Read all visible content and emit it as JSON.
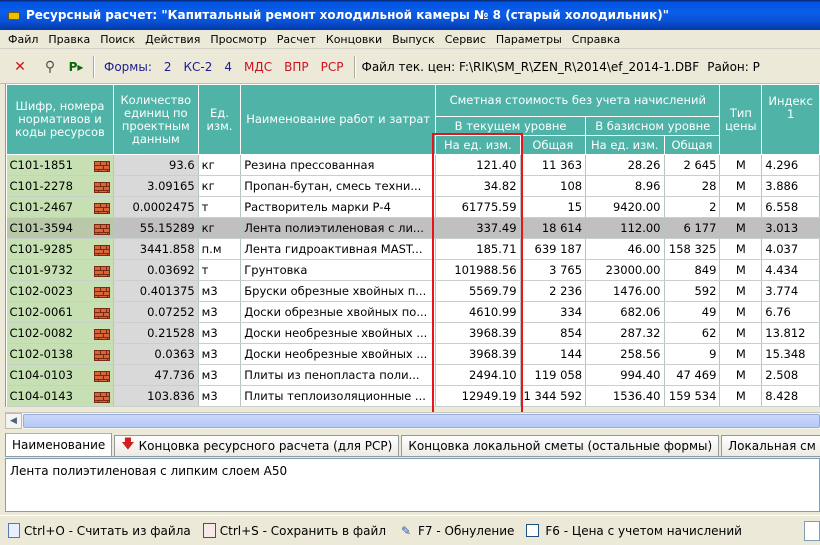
{
  "window": {
    "title": "Ресурсный расчет: \"Капитальный ремонт холодильной камеры № 8 (старый холодильник)\""
  },
  "menu": [
    "Файл",
    "Правка",
    "Поиск",
    "Действия",
    "Просмотр",
    "Расчет",
    "Концовки",
    "Выпуск",
    "Сервис",
    "Параметры",
    "Справка"
  ],
  "toolbar": {
    "delete_icon": "✕",
    "binoculars_icon": "⚲",
    "run_icon": "P▸",
    "forms_label": "Формы:",
    "forms": [
      "2",
      "КС-2",
      "4",
      "МДС",
      "ВПР",
      "РСР"
    ],
    "file_label": "Файл тек. цен: F:\\RIK\\SM_R\\ZEN_R\\2014\\ef_2014-1.DBF",
    "region_label": "Район: Р"
  },
  "grid": {
    "headers": {
      "code": "Шифр, номера нормативов и коды ресурсов",
      "qty": "Количество единиц по проектным данным",
      "unit": "Ед. изм.",
      "name": "Наименование работ и затрат",
      "cost_group": "Сметная стоимость без учета начислений",
      "current_level": "В текущем уровне",
      "base_level": "В базисном уровне",
      "per_unit_cur": "На ед. изм.",
      "total_cur": "Общая",
      "per_unit_base": "На ед. изм.",
      "total_base": "Общая",
      "price_type": "Тип цены",
      "index": "Индекс 1"
    },
    "rows": [
      {
        "code": "С101-1851",
        "qty": "93.6",
        "unit": "кг",
        "name": "Резина прессованная",
        "cur_unit": "121.40",
        "cur_total": "11 363",
        "base_unit": "28.26",
        "base_total": "2 645",
        "type": "М",
        "index": "4.296"
      },
      {
        "code": "С101-2278",
        "qty": "3.09165",
        "unit": "кг",
        "name": "Пропан-бутан, смесь техни...",
        "cur_unit": "34.82",
        "cur_total": "108",
        "base_unit": "8.96",
        "base_total": "28",
        "type": "М",
        "index": "3.886"
      },
      {
        "code": "С101-2467",
        "qty": "0.0002475",
        "unit": "т",
        "name": "Растворитель марки Р-4",
        "cur_unit": "61775.59",
        "cur_total": "15",
        "base_unit": "9420.00",
        "base_total": "2",
        "type": "М",
        "index": "6.558"
      },
      {
        "code": "С101-3594",
        "qty": "55.15289",
        "unit": "кг",
        "name": "Лента полиэтиленовая с ли...",
        "cur_unit": "337.49",
        "cur_total": "18 614",
        "base_unit": "112.00",
        "base_total": "6 177",
        "type": "М",
        "index": "3.013"
      },
      {
        "code": "С101-9285",
        "qty": "3441.858",
        "unit": "п.м",
        "name": "Лента гидроактивная MAST...",
        "cur_unit": "185.71",
        "cur_total": "639 187",
        "base_unit": "46.00",
        "base_total": "158 325",
        "type": "М",
        "index": "4.037"
      },
      {
        "code": "С101-9732",
        "qty": "0.03692",
        "unit": "т",
        "name": "Грунтовка",
        "cur_unit": "101988.56",
        "cur_total": "3 765",
        "base_unit": "23000.00",
        "base_total": "849",
        "type": "М",
        "index": "4.434"
      },
      {
        "code": "С102-0023",
        "qty": "0.401375",
        "unit": "м3",
        "name": "Бруски обрезные хвойных п...",
        "cur_unit": "5569.79",
        "cur_total": "2 236",
        "base_unit": "1476.00",
        "base_total": "592",
        "type": "М",
        "index": "3.774"
      },
      {
        "code": "С102-0061",
        "qty": "0.07252",
        "unit": "м3",
        "name": "Доски обрезные хвойных по...",
        "cur_unit": "4610.99",
        "cur_total": "334",
        "base_unit": "682.06",
        "base_total": "49",
        "type": "М",
        "index": "6.76"
      },
      {
        "code": "С102-0082",
        "qty": "0.21528",
        "unit": "м3",
        "name": "Доски необрезные хвойных ...",
        "cur_unit": "3968.39",
        "cur_total": "854",
        "base_unit": "287.32",
        "base_total": "62",
        "type": "М",
        "index": "13.812"
      },
      {
        "code": "С102-0138",
        "qty": "0.0363",
        "unit": "м3",
        "name": "Доски необрезные хвойных ...",
        "cur_unit": "3968.39",
        "cur_total": "144",
        "base_unit": "258.56",
        "base_total": "9",
        "type": "М",
        "index": "15.348"
      },
      {
        "code": "С104-0103",
        "qty": "47.736",
        "unit": "м3",
        "name": "Плиты из пенопласта поли...",
        "cur_unit": "2494.10",
        "cur_total": "119 058",
        "base_unit": "994.40",
        "base_total": "47 469",
        "type": "М",
        "index": "2.508"
      },
      {
        "code": "С104-0143",
        "qty": "103.836",
        "unit": "м3",
        "name": "Плиты теплоизоляционные ...",
        "cur_unit": "12949.19",
        "cur_total": "1 344 592",
        "base_unit": "1536.40",
        "base_total": "159 534",
        "type": "М",
        "index": "8.428"
      }
    ],
    "selected_row": 3
  },
  "tabs": [
    "Наименование",
    "Концовка ресурсного расчета (для РСР)",
    "Концовка локальной сметы (остальные формы)",
    "Локальная см"
  ],
  "memo": {
    "text": "Лента полиэтиленовая с липким слоем А50"
  },
  "statusbar": {
    "load": "Ctrl+O - Считать из файла",
    "save": "Ctrl+S - Сохранить в файл",
    "reset": "F7 - Обнуление",
    "price": "F6 - Цена  с учетом начислений"
  },
  "colors": {
    "header_bg": "#4fb3a8",
    "code_bg": "#c6e0b4",
    "qty_bg": "#d9d9d9",
    "highlight": "#e8141c"
  }
}
